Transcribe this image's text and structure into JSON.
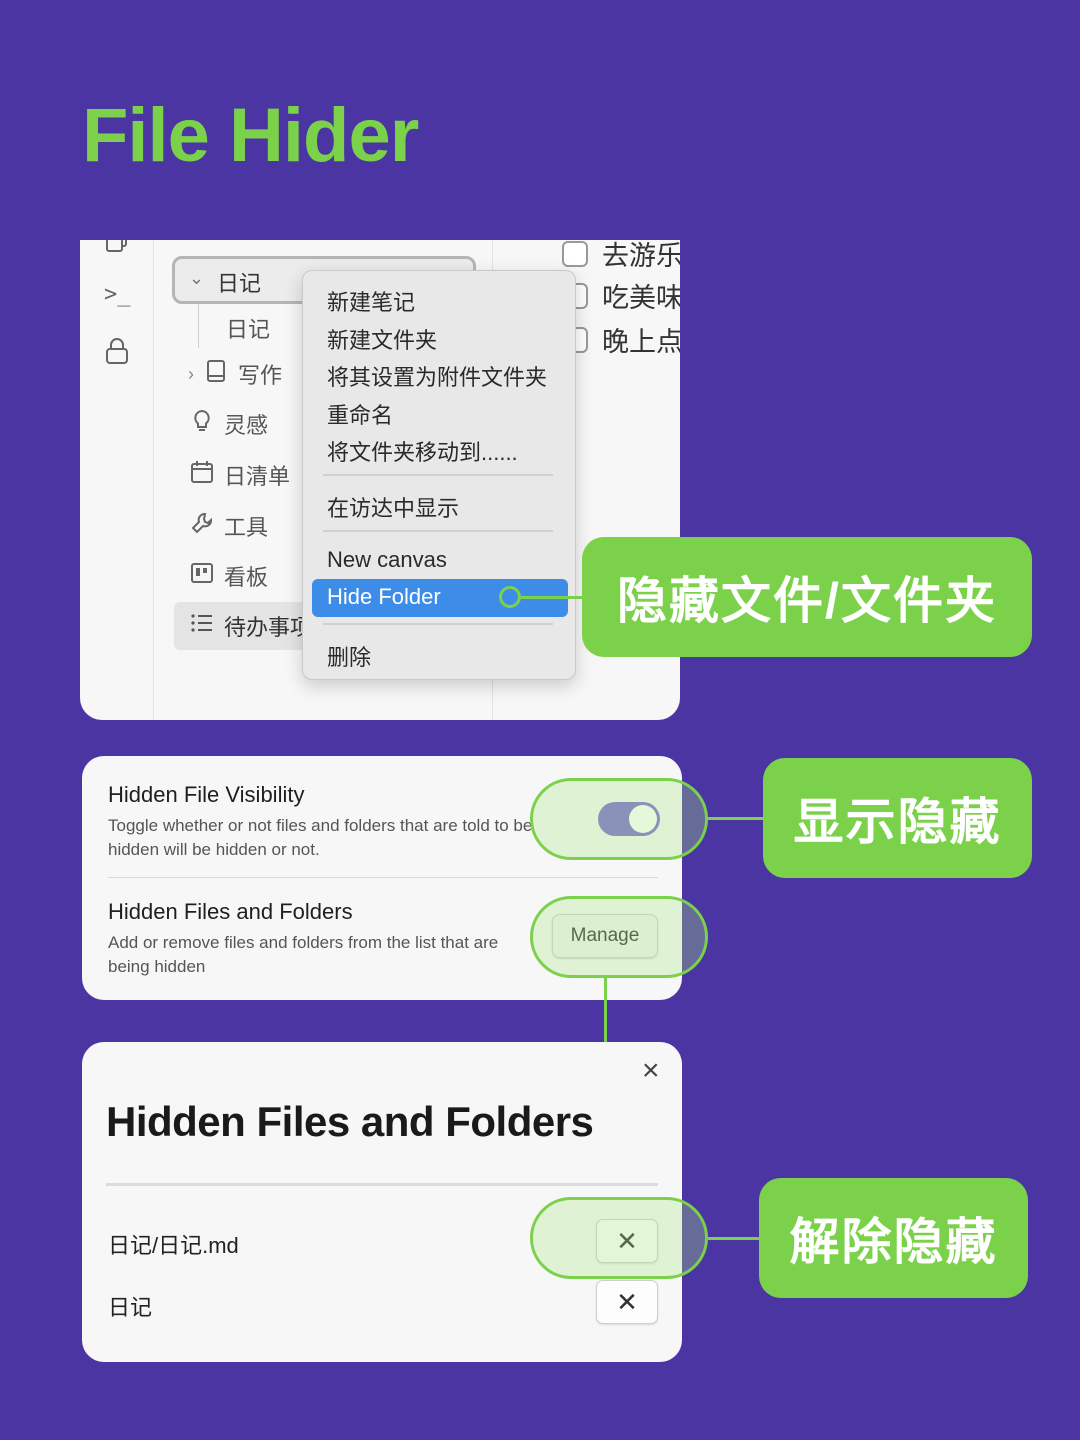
{
  "title": "File Hider",
  "colors": {
    "background": "#4a35a3",
    "accent_green": "#7bd14a",
    "highlight_blue": "#3d8de8",
    "toggle_purple": "#7b6fd3"
  },
  "ribbon": {
    "icons": [
      "copy-icon",
      "terminal-icon",
      "lock-icon"
    ],
    "terminal_glyph": ">_"
  },
  "explorer": {
    "selected_folder": "日记",
    "items": [
      {
        "label": "日记",
        "icon": ""
      },
      {
        "label": "写作",
        "icon": "book-icon"
      },
      {
        "label": "灵感",
        "icon": "lightbulb-icon"
      },
      {
        "label": "日清单",
        "icon": "calendar-icon"
      },
      {
        "label": "工具",
        "icon": "wrench-icon"
      },
      {
        "label": "看板",
        "icon": "kanban-icon"
      },
      {
        "label": "待办事项",
        "icon": "list-icon"
      }
    ]
  },
  "note": {
    "checklist": [
      "去游乐",
      "吃美味",
      "晚上点"
    ]
  },
  "context_menu": {
    "items": [
      "新建笔记",
      "新建文件夹",
      "将其设置为附件文件夹",
      "重命名",
      "将文件夹移动到......",
      "在访达中显示",
      "New canvas",
      "Hide Folder",
      "删除"
    ],
    "highlighted": "Hide Folder"
  },
  "labels": {
    "hide": "隐藏文件/文件夹",
    "show_hidden": "显示隐藏",
    "unhide": "解除隐藏"
  },
  "settings": {
    "visibility": {
      "title": "Hidden File Visibility",
      "desc": "Toggle whether or not files and folders that are told to be hidden will be hidden or not.",
      "toggle_on": true
    },
    "list": {
      "title": "Hidden Files and Folders",
      "desc": "Add or remove files and folders from the list that are being hidden",
      "button": "Manage"
    }
  },
  "modal": {
    "title": "Hidden Files and Folders",
    "close_glyph": "×",
    "remove_glyph": "✕",
    "items": [
      "日记/日记.md",
      "日记"
    ]
  }
}
